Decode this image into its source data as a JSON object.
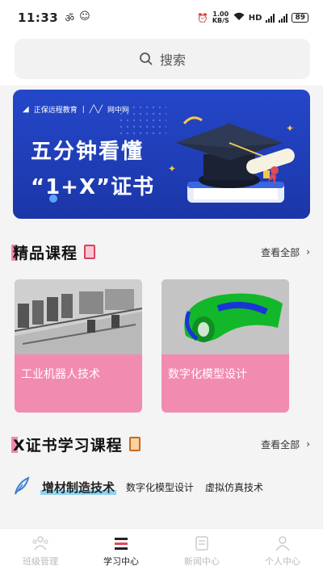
{
  "status_bar": {
    "time": "11:33",
    "speed_value": "1.00",
    "speed_unit": "KB/S",
    "hd": "HD",
    "battery": "89"
  },
  "search": {
    "placeholder": "搜索"
  },
  "banner": {
    "brand1": "正保远程教育",
    "brand2": "网中网",
    "line1": "五分钟看懂",
    "line2": "“1+X”证书"
  },
  "featured": {
    "title": "精品课程",
    "more": "查看全部",
    "courses": [
      {
        "label": "工业机器人技术"
      },
      {
        "label": "数字化模型设计"
      }
    ]
  },
  "cert": {
    "title": "X证书学习课程",
    "more": "查看全部",
    "tabs": [
      "增材制造技术",
      "数字化模型设计",
      "虚拟仿真技术"
    ]
  },
  "nav": {
    "items": [
      {
        "label": "班级管理"
      },
      {
        "label": "学习中心"
      },
      {
        "label": "新闻中心"
      },
      {
        "label": "个人中心"
      }
    ]
  },
  "colors": {
    "accent_pink": "#f28bb0",
    "banner_blue": "#1f3fbd",
    "tab_highlight": "#8fd3f0"
  }
}
